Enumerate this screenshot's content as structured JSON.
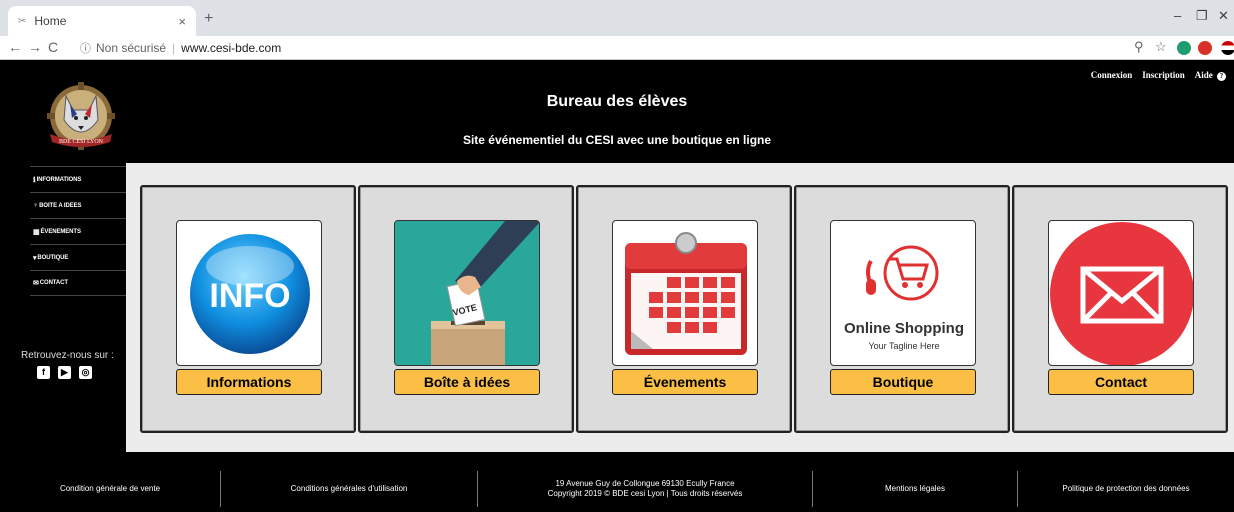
{
  "browser": {
    "tab_title": "Home",
    "tab_close": "×",
    "new_tab": "+",
    "security_label": "Non sécurisé",
    "url": "www.cesi-bde.com"
  },
  "header": {
    "title": "Bureau des élèves",
    "subtitle": "Site événementiel du CESI avec une boutique en ligne",
    "logo_text": "BDE CESI LYON",
    "links": {
      "login": "Connexion",
      "signup": "Inscription",
      "help": "Aide"
    }
  },
  "sidebar": {
    "items": [
      {
        "icon": "info-icon",
        "label": "INFORMATIONS"
      },
      {
        "icon": "lightbulb-icon",
        "label": "BOITE A IDEES"
      },
      {
        "icon": "calendar-icon",
        "label": "ÉVENEMENTS"
      },
      {
        "icon": "cart-icon",
        "label": "BOUTIQUE"
      },
      {
        "icon": "envelope-icon",
        "label": "CONTACT"
      }
    ],
    "follow_text": "Retrouvez-nous sur :",
    "social": [
      "facebook-icon",
      "youtube-icon",
      "instagram-icon"
    ]
  },
  "cards": [
    {
      "label": "Informations",
      "image_text": "INFO"
    },
    {
      "label": "Boîte à idées",
      "image_text": "VOTE"
    },
    {
      "label": "Évenements",
      "image_text": ""
    },
    {
      "label": "Boutique",
      "image_text": "Online Shopping",
      "image_subtext": "Your Tagline Here"
    },
    {
      "label": "Contact",
      "image_text": ""
    }
  ],
  "footer": {
    "items": [
      "Condition générale de vente",
      "Conditions générales d'utilisation",
      "19 Avenue Guy de Collongue 69130 Ecully France",
      "Copyright 2019 © BDE cesi Lyon | Tous droits réservés",
      "Mentions légales",
      "Politique de protection des données"
    ]
  },
  "colors": {
    "button": "#fbbf45",
    "background": "#000000",
    "main_bg": "#ececec",
    "card_bg": "#dcdcdc"
  }
}
